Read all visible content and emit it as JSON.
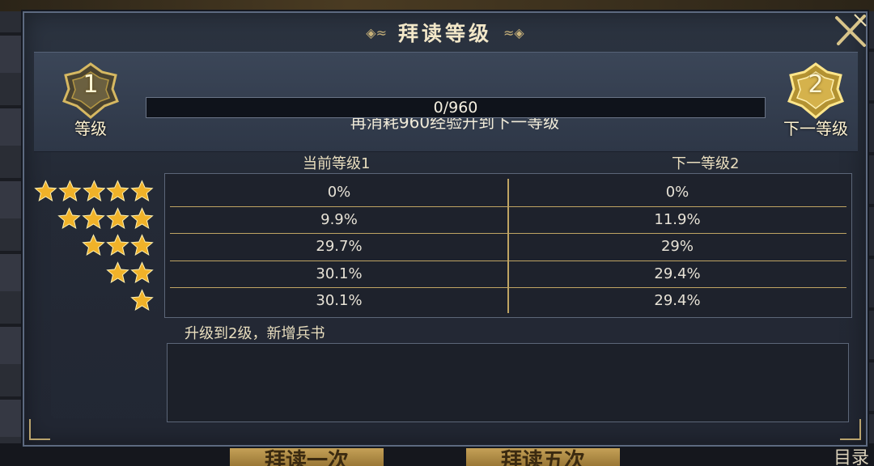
{
  "dialog": {
    "title": "拜读等级",
    "current_level": {
      "number": "1",
      "caption": "等级"
    },
    "next_level": {
      "number": "2",
      "caption": "下一等级"
    },
    "exp_hint": "再消耗960经验升到下一等级",
    "exp_progress": {
      "text": "0/960",
      "current": 0,
      "max": 960
    },
    "columns": {
      "current": "当前等级1",
      "next": "下一等级2"
    },
    "rate_rows": [
      {
        "stars": 5,
        "current": "0%",
        "next": "0%"
      },
      {
        "stars": 4,
        "current": "9.9%",
        "next": "11.9%"
      },
      {
        "stars": 3,
        "current": "29.7%",
        "next": "29%"
      },
      {
        "stars": 2,
        "current": "30.1%",
        "next": "29.4%"
      },
      {
        "stars": 1,
        "current": "30.1%",
        "next": "29.4%"
      }
    ],
    "unlock_text": "升级到2级，新增兵书"
  },
  "background": {
    "button_1": "拜读一次",
    "button_2": "拜读五次",
    "directory_label": "目录"
  },
  "colors": {
    "gold": "#bfa463",
    "star": "#f0b229",
    "panel": "#2c3441"
  },
  "icons": {
    "close": "close-x-icon",
    "star": "star-icon",
    "badge": "level-badge-icon"
  }
}
